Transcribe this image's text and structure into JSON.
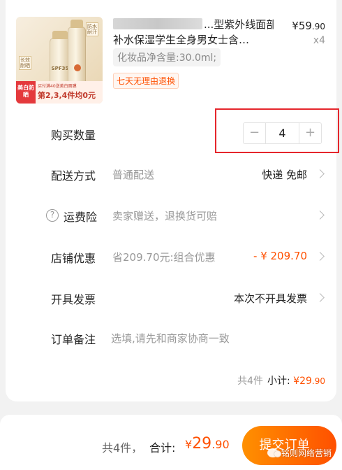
{
  "product": {
    "title_line1_visible": "...型紫外线面部",
    "title_line2": "补水保湿学生全身男女士含…",
    "price_currency": "¥",
    "price_yuan": "59",
    "price_cents": ".90",
    "quantity_label": "x4",
    "sku": "化妆品净含量:30.0ml;",
    "return_tag": "七天无理由退换",
    "image": {
      "bottle_text": "SPF35",
      "side_tag": "防水耐汗",
      "side_tag2": "长效耐晒",
      "red_badge": "美白防晒",
      "promo_small": "买付满40送美白面膜",
      "promo_big": "第2,3,4件均0元"
    }
  },
  "rows": {
    "quantity": {
      "label": "购买数量",
      "value": "4",
      "minus": "−",
      "plus": "+"
    },
    "delivery": {
      "label": "配送方式",
      "sub": "普通配送",
      "value": "快递 免邮"
    },
    "insurance": {
      "icon": "?",
      "label": "运费险",
      "sub": "卖家赠送，退换货可赔"
    },
    "discount": {
      "label": "店铺优惠",
      "sub": "省209.70元:组合优惠",
      "value": "- ¥ 209.70"
    },
    "invoice": {
      "label": "开具发票",
      "value": "本次不开具发票"
    },
    "note": {
      "label": "订单备注",
      "placeholder": "选填,请先和商家协商一致"
    }
  },
  "subtotal": {
    "count": "共4件",
    "label": "小计:",
    "currency": "¥",
    "yuan": "29",
    "cents": ".90"
  },
  "footer": {
    "count": "共4件，",
    "label": "合计:",
    "currency": "¥",
    "yuan": "29",
    "cents": ".90",
    "submit": "提交订单",
    "watermark": "铭则网络营销"
  },
  "colors": {
    "accent": "#ff5000",
    "highlight": "#e5262c",
    "button_gradient_start": "#ff9000"
  },
  "icons": [
    "minus-icon",
    "plus-icon",
    "chevron-right-icon",
    "question-icon",
    "wechat-watermark-icon"
  ]
}
